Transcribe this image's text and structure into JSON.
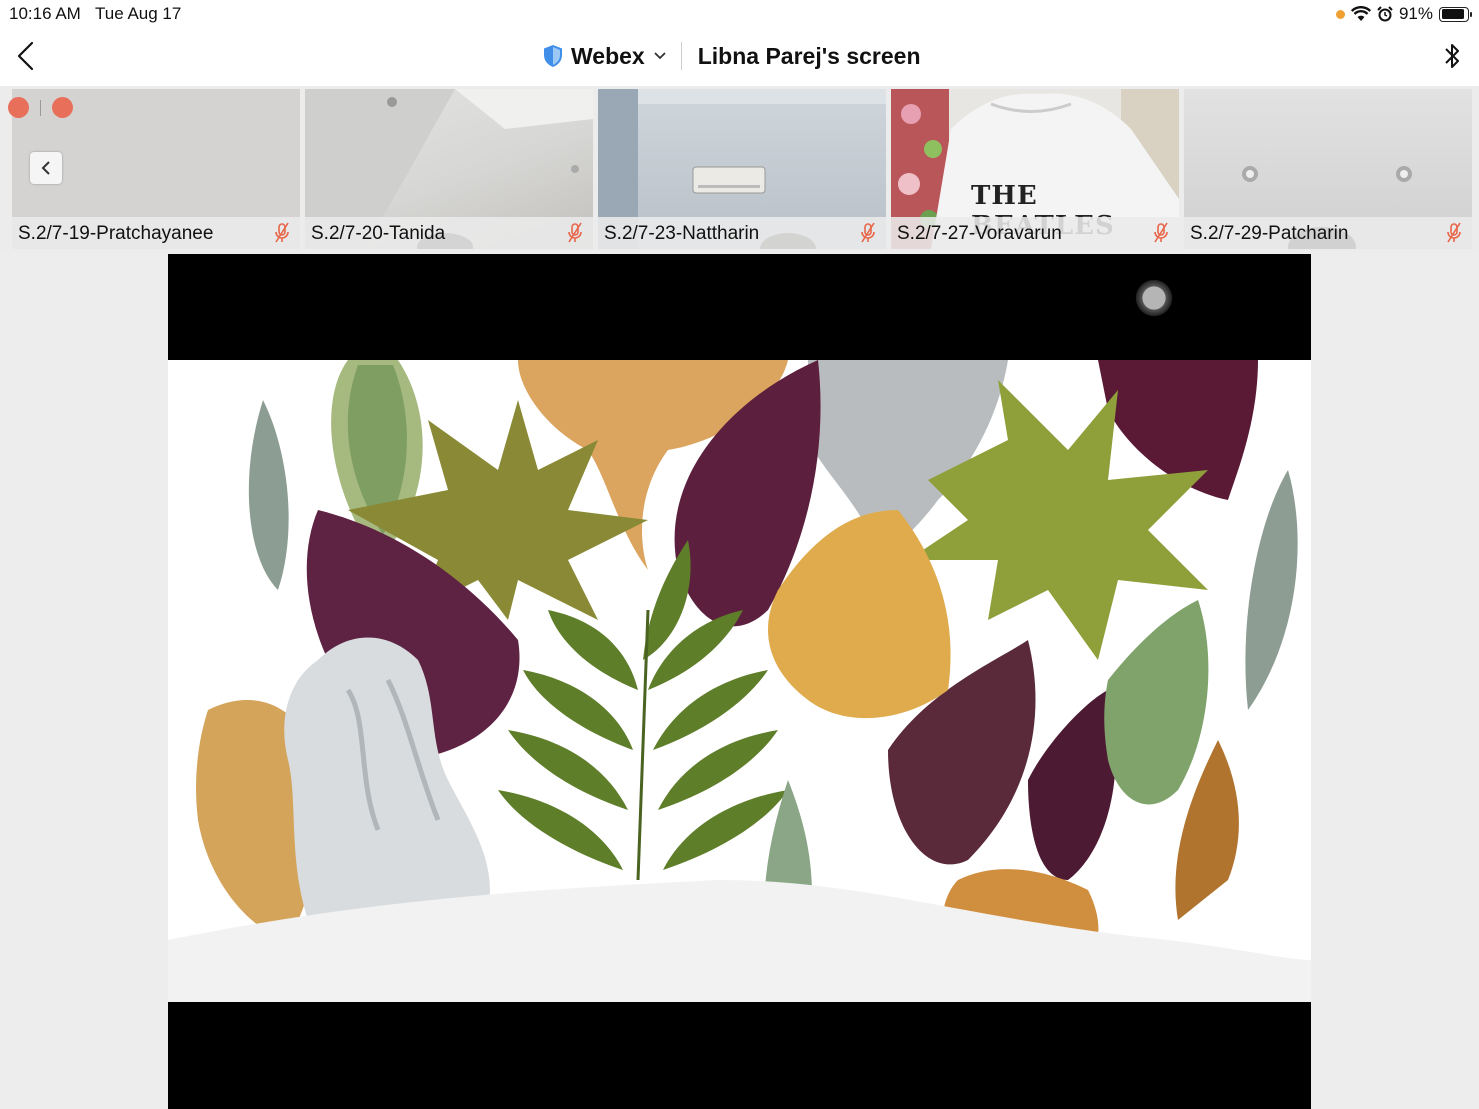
{
  "status_bar": {
    "time": "10:16 AM",
    "date": "Tue Aug 17",
    "battery": "91%",
    "battery_level": 0.91
  },
  "nav": {
    "back_icon": "chevron-left-icon",
    "app_name": "Webex",
    "screen_title": "Libna Parej's screen",
    "bluetooth_icon": "bluetooth-icon"
  },
  "participants": [
    {
      "name": "S.2/7-19-Pratchayanee",
      "muted": true
    },
    {
      "name": "S.2/7-20-Tanida",
      "muted": true
    },
    {
      "name": "S.2/7-23-Nattharin",
      "muted": true
    },
    {
      "name": "S.2/7-27-Voravarun",
      "muted": true
    },
    {
      "name": "S.2/7-29-Patcharin",
      "muted": true
    }
  ],
  "video_content": {
    "shirt_text": "THE BEATLES"
  },
  "colors": {
    "mute_icon": "#e8664a",
    "webex_shield": "#3f8ee8",
    "leaf_maroon": "#5a1a35",
    "leaf_olive": "#6b8a2a",
    "leaf_yellow": "#d9a84a",
    "leaf_silver": "#d8dcde"
  }
}
